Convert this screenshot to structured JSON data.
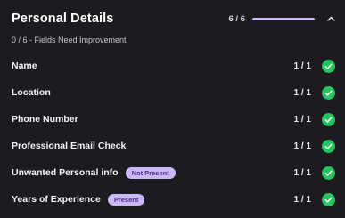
{
  "header": {
    "title": "Personal Details",
    "progress_text": "6 / 6",
    "progress_fraction": 1.0,
    "collapse_icon": "chevron-up-icon"
  },
  "subtitle": "0 / 6 - Fields Need Improvement",
  "colors": {
    "background": "#1c1b1f",
    "accent": "#cdbcf5",
    "success": "#22c55e",
    "badge_bg": "#cbb8f7",
    "badge_text": "#4b2f8c"
  },
  "rows": [
    {
      "label": "Name",
      "badge": "",
      "score": "1 / 1",
      "status_icon": "check-circle-icon"
    },
    {
      "label": "Location",
      "badge": "",
      "score": "1 / 1",
      "status_icon": "check-circle-icon"
    },
    {
      "label": "Phone Number",
      "badge": "",
      "score": "1 / 1",
      "status_icon": "check-circle-icon"
    },
    {
      "label": "Professional Email Check",
      "badge": "",
      "score": "1 / 1",
      "status_icon": "check-circle-icon"
    },
    {
      "label": "Unwanted Personal info",
      "badge": "Not Present",
      "score": "1 / 1",
      "status_icon": "check-circle-icon"
    },
    {
      "label": "Years of Experience",
      "badge": "Present",
      "score": "1 / 1",
      "status_icon": "check-circle-icon"
    }
  ]
}
